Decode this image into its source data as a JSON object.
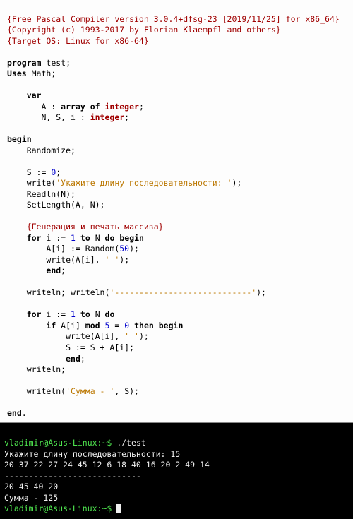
{
  "code": {
    "comp1": "{Free Pascal Compiler version 3.0.4+dfsg-23 [2019/11/25] for x86_64}",
    "comp2": "{Copyright (c) 1993-2017 by Florian Klaempfl and others}",
    "comp3": "{Target OS: Linux for x86-64}",
    "kw_program": "program",
    "prog_name": " test;",
    "kw_uses": "Uses",
    "uses_name": " Math;",
    "kw_var": "var",
    "var_a_pre": "       A : ",
    "kw_array_of": "array of",
    "ty_integer1": " integer",
    "semi1": ";",
    "var_nsi_pre": "       N, S, i : ",
    "ty_integer2": "integer",
    "semi2": ";",
    "kw_begin": "begin",
    "randomize": "    Randomize;",
    "s0_pre": "    S := ",
    "zero": "0",
    "s0_post": ";",
    "write1a": "    write(",
    "write1str": "'Укажите длину последовательности: '",
    "write1b": ");",
    "readln": "    Readln(N);",
    "setlen": "    SetLength(A, N);",
    "comment_gen": "    {Генерация и печать массива}",
    "for1_a": "    ",
    "kw_for1": "for",
    "for1_b": " i := ",
    "one1": "1",
    "for1_c": " ",
    "kw_to1": "to",
    "for1_d": " N ",
    "kw_do1": "do",
    "for1_e": " ",
    "kw_begin1": "begin",
    "rand_a": "        A[i] := Random(",
    "fifty": "50",
    "rand_b": ");",
    "write2a": "        write(A[i], ",
    "write2str": "' '",
    "write2b": ");",
    "end1_pre": "        ",
    "kw_end1": "end",
    "end1_post": ";",
    "wr_ln_a": "    writeln; writeln(",
    "wr_ln_str": "'----------------------------'",
    "wr_ln_b": ");",
    "for2_a": "    ",
    "kw_for2": "for",
    "for2_b": " i := ",
    "one2": "1",
    "for2_c": " ",
    "kw_to2": "to",
    "for2_d": " N ",
    "kw_do2": "do",
    "if_a": "        ",
    "kw_if": "if",
    "if_b": " A[i] ",
    "kw_mod": "mod",
    "if_c": " ",
    "five": "5",
    "if_d": " = ",
    "zero2": "0",
    "if_e": " ",
    "kw_then": "then",
    "if_f": " ",
    "kw_begin2": "begin",
    "write3a": "            write(A[i], ",
    "write3str": "' '",
    "write3b": ");",
    "ssum": "            S := S + A[i];",
    "end2_pre": "            ",
    "kw_end2": "end",
    "end2_post": ";",
    "writeln2": "    writeln;",
    "write4a": "    writeln(",
    "write4str": "'Сумма - '",
    "write4b": ", S);",
    "kw_end_final": "end",
    "dot": "."
  },
  "terminal": {
    "line1_prompt": "vladimir@Asus-Linux:~$",
    "line1_cmd": " ./test",
    "line2": "Укажите длину последовательности: 15",
    "line3": "20 37 22 27 24 45 12 6 18 40 16 20 2 49 14 ",
    "line4": "----------------------------",
    "line5": "20 45 40 20 ",
    "line6": "Сумма - 125",
    "line7_prompt": "vladimir@Asus-Linux:~$",
    "line7_cmd": " "
  }
}
